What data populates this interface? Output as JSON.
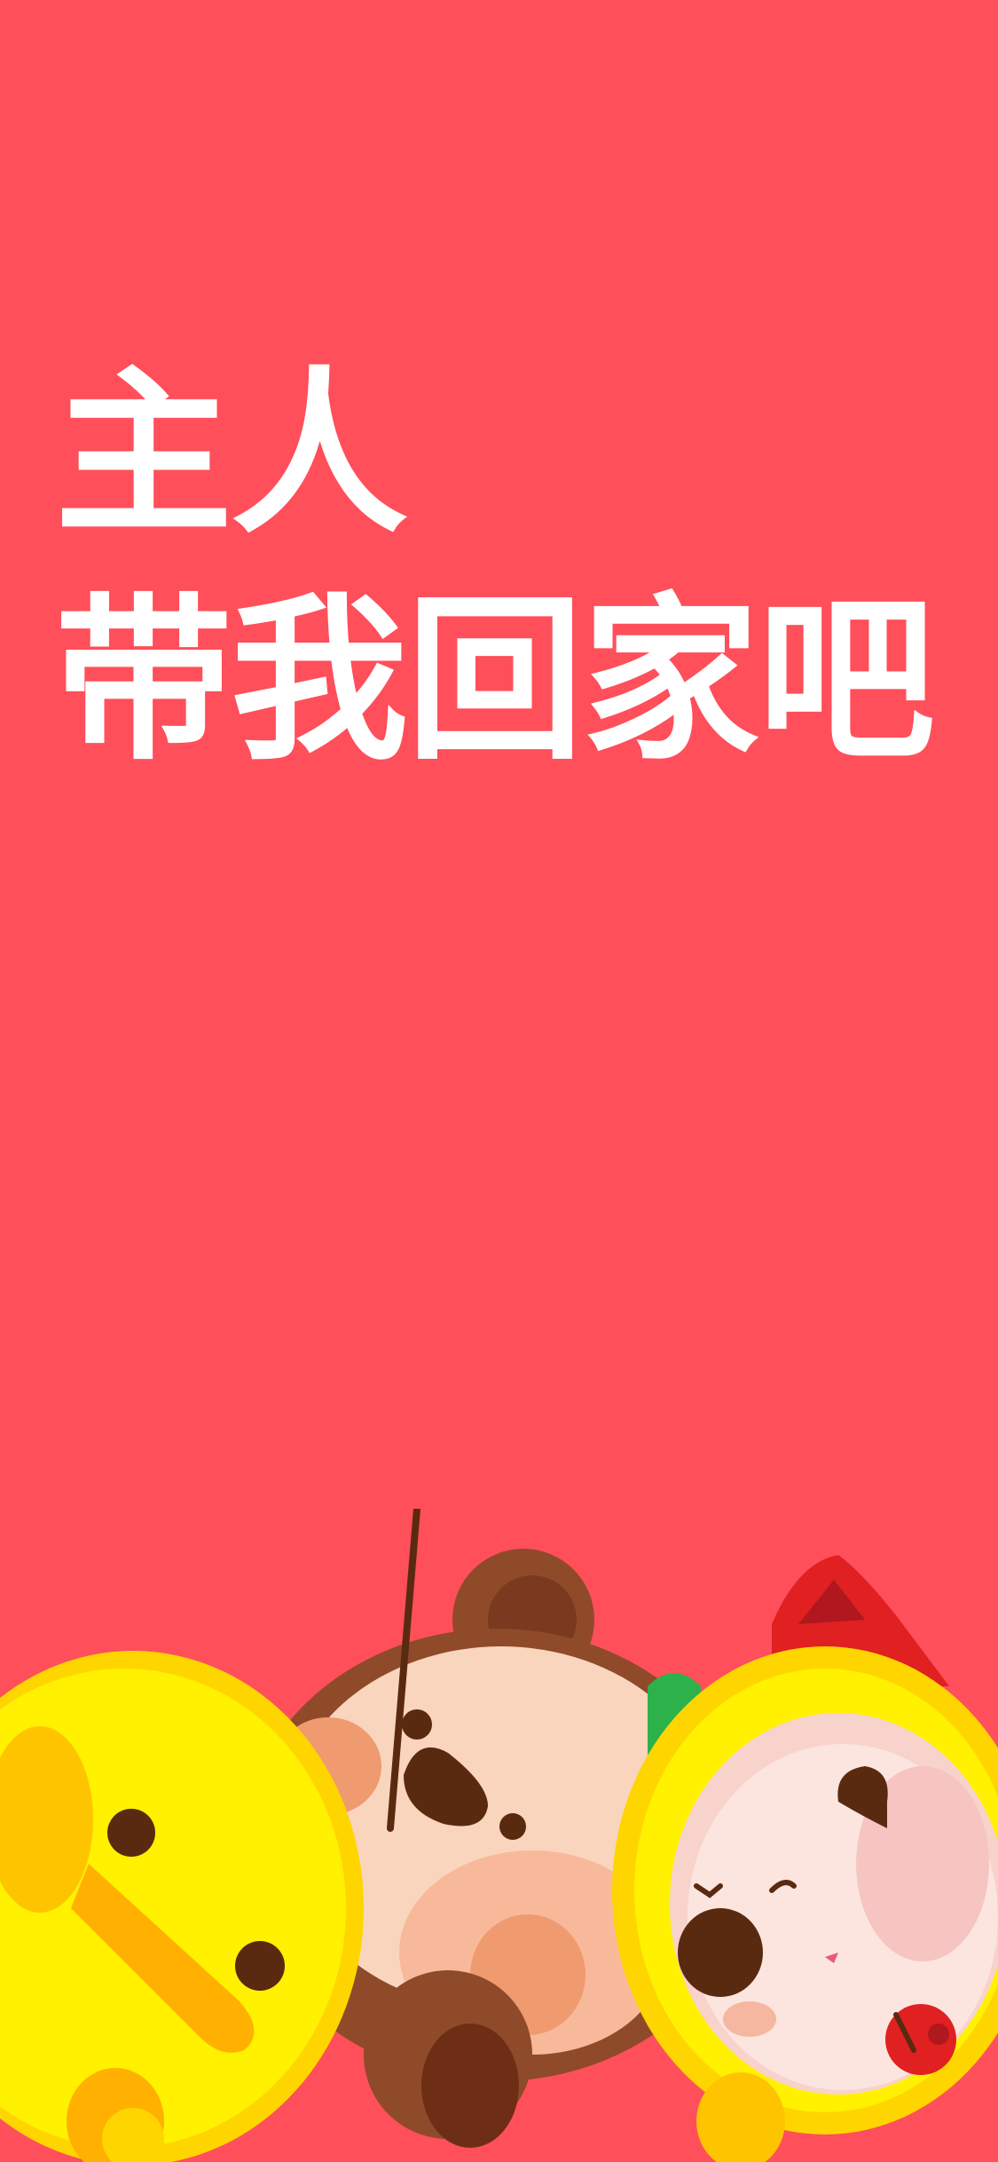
{
  "screen": {
    "background_color": "#FF4F5A"
  },
  "headline": {
    "line1": "主人",
    "line2": "带我回家吧",
    "color": "#FFFFFF"
  },
  "illustration": {
    "characters": [
      "yellow-duck",
      "brown-monkey",
      "yellow-hooded-cat"
    ]
  }
}
